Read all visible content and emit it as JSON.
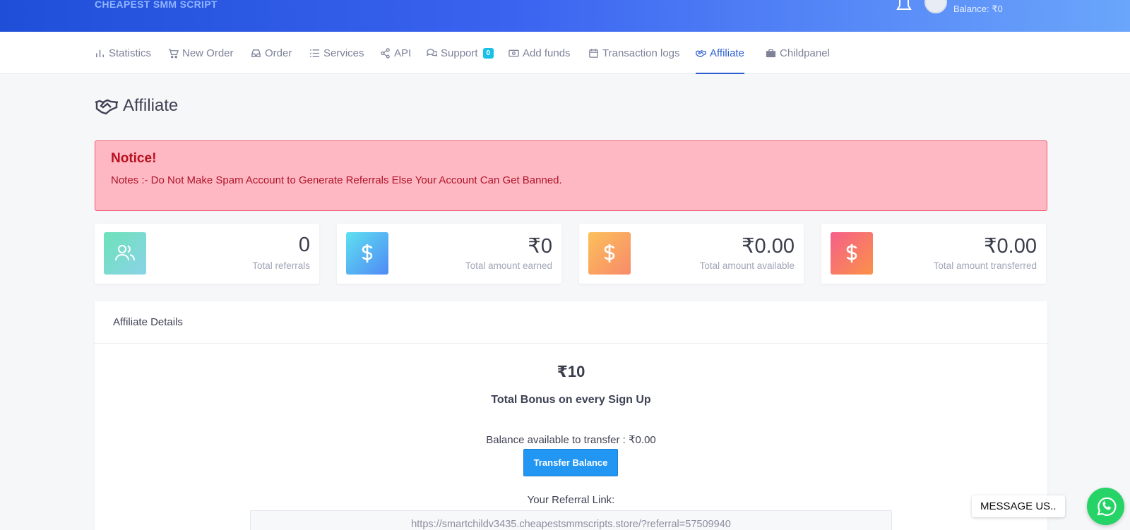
{
  "header": {
    "brand": "CHEAPEST SMM SCRIPT",
    "balance": "Balance: ₹0"
  },
  "nav": {
    "items": [
      {
        "label": "Statistics",
        "icon": "bar-chart-icon"
      },
      {
        "label": "New Order",
        "icon": "cart-icon"
      },
      {
        "label": "Order",
        "icon": "inbox-icon"
      },
      {
        "label": "Services",
        "icon": "list-icon"
      },
      {
        "label": "API",
        "icon": "share-icon"
      },
      {
        "label": "Support",
        "icon": "chat-icon",
        "badge": "0"
      },
      {
        "label": "Add funds",
        "icon": "money-icon"
      },
      {
        "label": "Transaction logs",
        "icon": "calendar-icon"
      },
      {
        "label": "Affiliate",
        "icon": "handshake-icon",
        "active": true
      },
      {
        "label": "Childpanel",
        "icon": "briefcase-icon"
      }
    ]
  },
  "page": {
    "title": "Affiliate"
  },
  "notice": {
    "title": "Notice!",
    "text": "Notes :- Do Not Make Spam Account to Generate Referrals Else Your Account Can Get Banned."
  },
  "stats": [
    {
      "value": "0",
      "label": "Total referrals",
      "icon": "users-icon"
    },
    {
      "value": "₹0",
      "label": "Total amount earned",
      "icon": "dollar-icon"
    },
    {
      "value": "₹0.00",
      "label": "Total amount available",
      "icon": "dollar-icon"
    },
    {
      "value": "₹0.00",
      "label": "Total amount transferred",
      "icon": "dollar-icon"
    }
  ],
  "details": {
    "header": "Affiliate Details",
    "bonus_amount": "₹10",
    "bonus_text": "Total Bonus on every Sign Up",
    "available": "Balance available to transfer : ₹0.00",
    "transfer_button": "Transfer Balance",
    "referral_label": "Your Referral Link:",
    "referral_link": "https://smartchildv3435.cheapestsmmscripts.store/?referral=57509940"
  },
  "chat": {
    "message": "MESSAGE US.."
  },
  "colors": {
    "primary": "#2d5fd0",
    "notice_bg": "#feb8c3",
    "notice_text": "#b8101f",
    "button": "#2196f3",
    "whatsapp": "#25d366"
  }
}
